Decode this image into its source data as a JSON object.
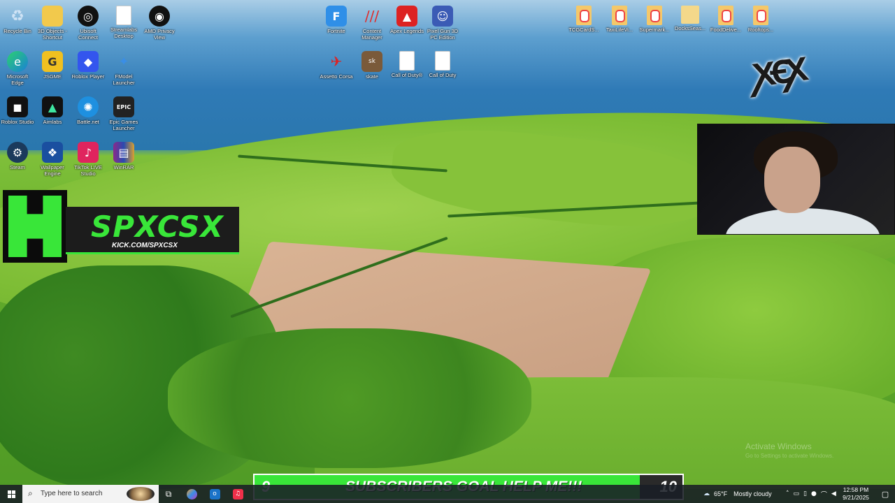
{
  "desktop_icons": {
    "recycle_bin": "Recycle Bin",
    "objects_3d": "3D Objects - Shortcut",
    "ubisoft": "Ubisoft Connect",
    "streamlabs": "Streamlabs Desktop",
    "amd_privacy": "AMD Privacy View",
    "fortnite": "Fortnite",
    "content_manager": "Content Manager",
    "apex": "Apex Legends",
    "pixel_gun": "Pixel Gun 3D PC Edition",
    "edge": "Microsoft Edge",
    "jsgme": "JSGME",
    "roblox_player": "Roblox Player",
    "fmod": "FModel Launcher",
    "assetto": "Assetto Corsa",
    "skate": "skate",
    "cod1": "Call of Duty®",
    "cod2": "Call of Duty",
    "roblox_studio": "Roblox Studio",
    "aimlabs": "Aimlabs",
    "battlenet": "Battle.net",
    "epic": "Epic Games Launcher",
    "steam": "Steam",
    "wallpaper": "Wallpaper Engine",
    "tiktok": "TikTok LIVE Studio",
    "winrar": "WinRAR",
    "file1": "TCGCardS...",
    "file2": "TaxiLifeVi...",
    "file3": "Supermark...",
    "folder1": "DocksSeas...",
    "file4": "FoodDelive...",
    "file5": "Rooftops..."
  },
  "overlay": {
    "brand_name": "SPXCSX",
    "brand_url": "KICK.COM/SPXCSX",
    "goal_current": "9",
    "goal_text": "SUBSCRIBERS GOAL HELP ME!!!",
    "goal_target": "10",
    "goal_progress_fraction": 0.9,
    "accent": "#39e639"
  },
  "watermark": {
    "line1": "Activate Windows",
    "line2": "Go to Settings to activate Windows."
  },
  "taskbar": {
    "search_placeholder": "Type here to search",
    "weather_temp": "65°F",
    "weather_text": "Mostly cloudy",
    "time": "12:58 PM",
    "date": "9/21/2025"
  }
}
